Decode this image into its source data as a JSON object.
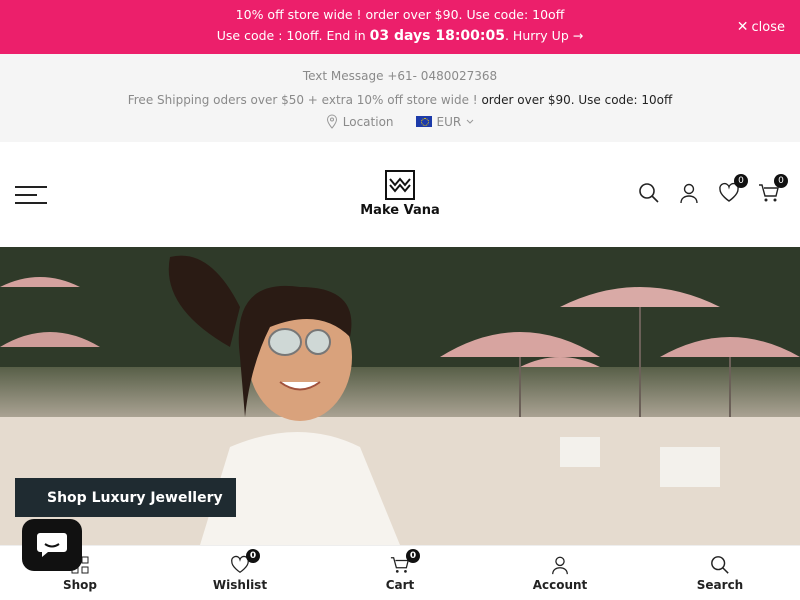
{
  "promo": {
    "line1": "10% off store wide ! order over $90. Use code: 10off",
    "line2_prefix": "Use code : 10off. End in ",
    "timer": "03 days 18:00:05",
    "line2_suffix": ". Hurry Up →",
    "close_label": "close"
  },
  "info": {
    "phone": "Text Message +61- 0480027368",
    "shipping_prefix": "Free Shipping oders over $50 + extra 10% off store wide ! ",
    "shipping_highlight": "order over $90. Use code: 10off",
    "location_label": "Location",
    "currency_label": "EUR"
  },
  "header": {
    "logo_text": "Make Vana",
    "wishlist_count": "0",
    "cart_count": "0"
  },
  "hero": {
    "button_label": "Shop Luxury Jewellery"
  },
  "bottom_nav": {
    "shop": "Shop",
    "wishlist": "Wishlist",
    "wishlist_count": "0",
    "cart": "Cart",
    "cart_count": "0",
    "account": "Account",
    "search": "Search"
  },
  "colors": {
    "promo_bg": "#ec1f6b",
    "button_bg": "#1f2b31"
  }
}
